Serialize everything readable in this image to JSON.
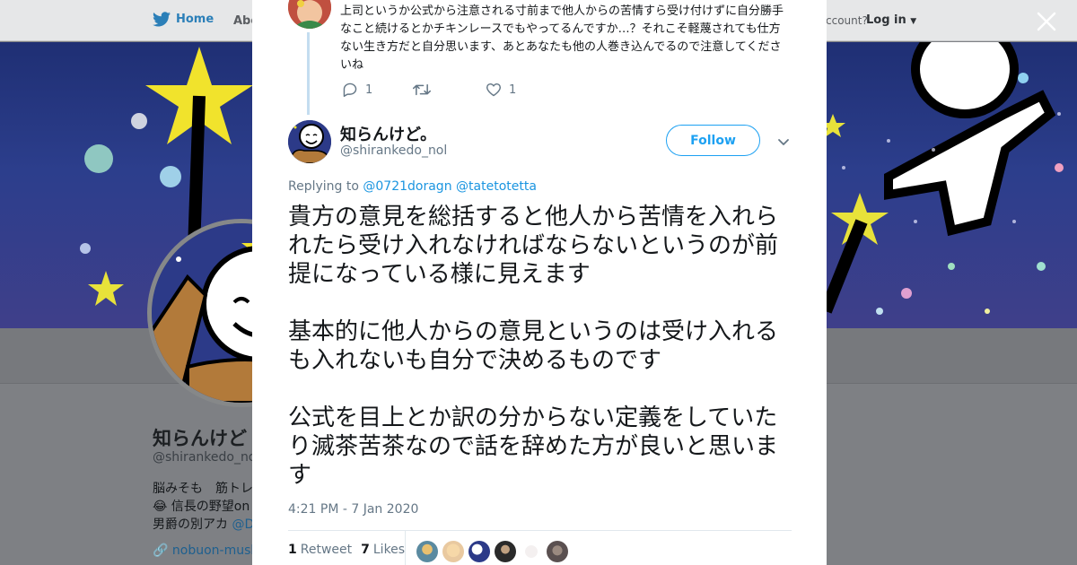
{
  "nav": {
    "home": "Home",
    "about": "Abo",
    "account_prompt": "ccount?",
    "login": "Log in"
  },
  "profile": {
    "name": "知らんけど",
    "handle": "@shirankedo_nol",
    "bio_line1": "脳みそも　筋トレ",
    "bio_line2": "😂 信長の野望on",
    "bio_line3_prefix": "男爵の別アカ ",
    "bio_line3_link": "@D",
    "link": "nobuon-mush"
  },
  "prev_tweet": {
    "text": "上司というか公式から注意される寸前まで他人からの苦情すら受け付けずに自分勝手なこと続けるとかチキンレースでもやってるんですか…？それこそ軽蔑されても仕方ない生き方だと自分思います、あとあなたも他の人巻き込んでるので注意してくださいね",
    "reply_count": "1",
    "retweet_count": "",
    "like_count": "1"
  },
  "tweet": {
    "display_name": "知らんけど。",
    "handle": "@shirankedo_nol",
    "follow_label": "Follow",
    "replying_prefix": "Replying to ",
    "mention1": "@0721doragn",
    "mention2": "@tatetotetta",
    "paragraphs": [
      "貴方の意見を総括すると他人から苦情を入れられたら受け入れなければならないというのが前提になっている様に見えます",
      "基本的に他人からの意見というのは受け入れるも入れないも自分で決めるものです",
      "公式を目上とか訳の分からない定義をしていたり滅茶苦茶なので話を辞めた方が良いと思います"
    ],
    "timestamp": "4:21 PM - 7 Jan 2020",
    "retweets_count": "1",
    "retweets_label": "Retweet",
    "likes_count": "7",
    "likes_label": "Likes"
  },
  "colors": {
    "twitter_blue": "#1da1f2",
    "mention_blue": "#1b95e0",
    "text_dark": "#14171a",
    "text_gray": "#657786"
  }
}
